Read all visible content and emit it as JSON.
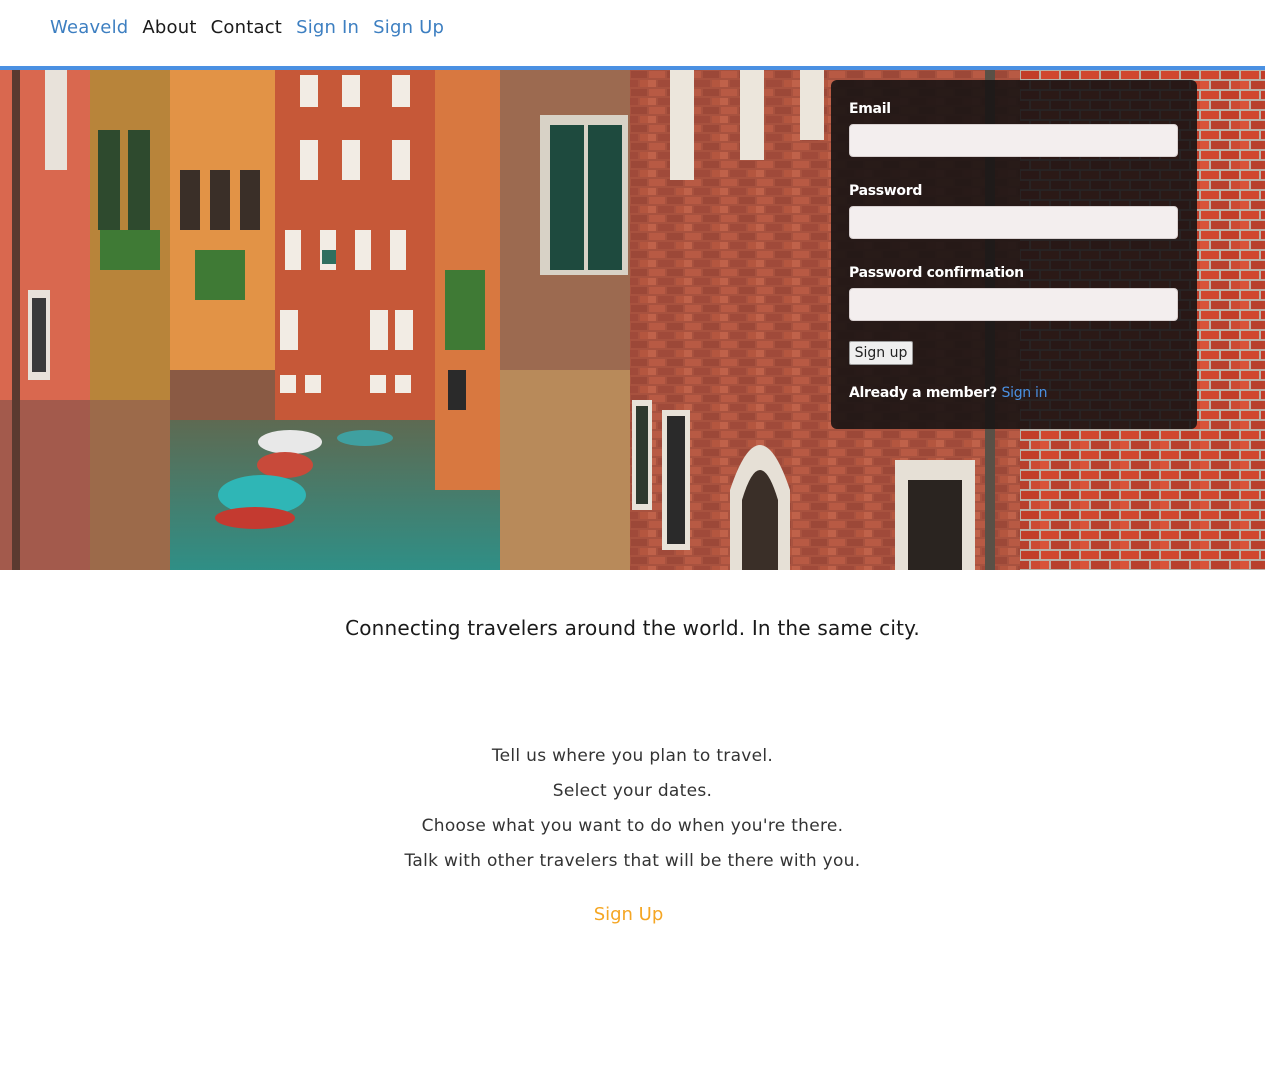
{
  "nav": {
    "brand": "Weaveld",
    "about": "About",
    "contact": "Contact",
    "sign_in": "Sign In",
    "sign_up": "Sign Up"
  },
  "signup_form": {
    "email_label": "Email",
    "email_value": "",
    "password_label": "Password",
    "password_value": "",
    "password_confirmation_label": "Password confirmation",
    "password_confirmation_value": "",
    "submit_label": "Sign up",
    "member_prompt": "Already a member?",
    "sign_in_link": "Sign in"
  },
  "tagline": "Connecting travelers around the world. In the same city.",
  "steps": [
    "Tell us where you plan to travel.",
    "Select your dates.",
    "Choose what you want to do when you're there.",
    "Talk with other travelers that will be there with you."
  ],
  "cta": "Sign Up",
  "colors": {
    "link_blue": "#3d7fc1",
    "accent_bar": "#4a90e2",
    "cta_orange": "#f5a623",
    "panel_bg": "#181414"
  },
  "hero_image": "venice-canal-photo"
}
